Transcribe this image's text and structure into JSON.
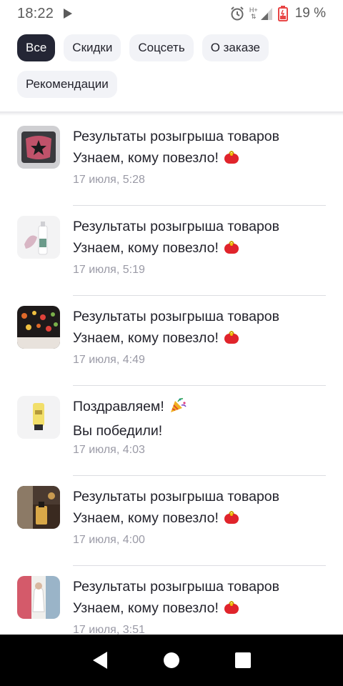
{
  "status_bar": {
    "time": "18:22",
    "network": "H+",
    "battery": "19 %"
  },
  "filters": [
    {
      "label": "Все",
      "active": true
    },
    {
      "label": "Скидки",
      "active": false
    },
    {
      "label": "Соцсеть",
      "active": false
    },
    {
      "label": "О заказе",
      "active": false
    },
    {
      "label": "Рекомендации",
      "active": false
    }
  ],
  "notifications": [
    {
      "title": "Результаты розыгрыша товаров",
      "subtitle": "Узнаем, кому повезло!",
      "emoji": "purse-icon",
      "date": "17 июля, 5:28"
    },
    {
      "title": "Результаты розыгрыша товаров",
      "subtitle": "Узнаем, кому повезло!",
      "emoji": "purse-icon",
      "date": "17 июля, 5:19"
    },
    {
      "title": "Результаты розыгрыша товаров",
      "subtitle": "Узнаем, кому повезло!",
      "emoji": "purse-icon",
      "date": "17 июля, 4:49"
    },
    {
      "title": "Поздравляем!",
      "subtitle": "Вы победили!",
      "emoji": "party-popper-icon",
      "date": "17 июля, 4:03"
    },
    {
      "title": "Результаты розыгрыша товаров",
      "subtitle": "Узнаем, кому повезло!",
      "emoji": "purse-icon",
      "date": "17 июля, 4:00"
    },
    {
      "title": "Результаты розыгрыша товаров",
      "subtitle": "Узнаем, кому повезло!",
      "emoji": "purse-icon",
      "date": "17 июля, 3:51"
    }
  ],
  "colors": {
    "chip_active_bg": "#242635",
    "chip_bg": "#f2f3f7",
    "text": "#23232c",
    "date_text": "#9a9aa6",
    "purse": "#e0242b"
  }
}
